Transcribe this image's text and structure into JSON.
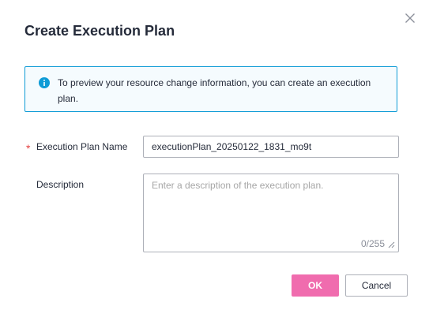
{
  "dialog": {
    "title": "Create Execution Plan",
    "close_icon": "close-icon"
  },
  "notice": {
    "icon": "info-icon",
    "text": "To preview your resource change information, you can create an execution plan.",
    "colors": {
      "border": "#0e9bd6",
      "background": "#f5fbfe"
    }
  },
  "form": {
    "name": {
      "label": "Execution Plan Name",
      "required_mark": "*",
      "value": "executionPlan_20250122_1831_mo9t"
    },
    "description": {
      "label": "Description",
      "placeholder": "Enter a description of the execution plan.",
      "value": "",
      "counter": "0/255"
    }
  },
  "footer": {
    "ok_label": "OK",
    "cancel_label": "Cancel"
  },
  "colors": {
    "primary": "#f06cae",
    "required": "#e54545",
    "text": "#252b3a"
  }
}
